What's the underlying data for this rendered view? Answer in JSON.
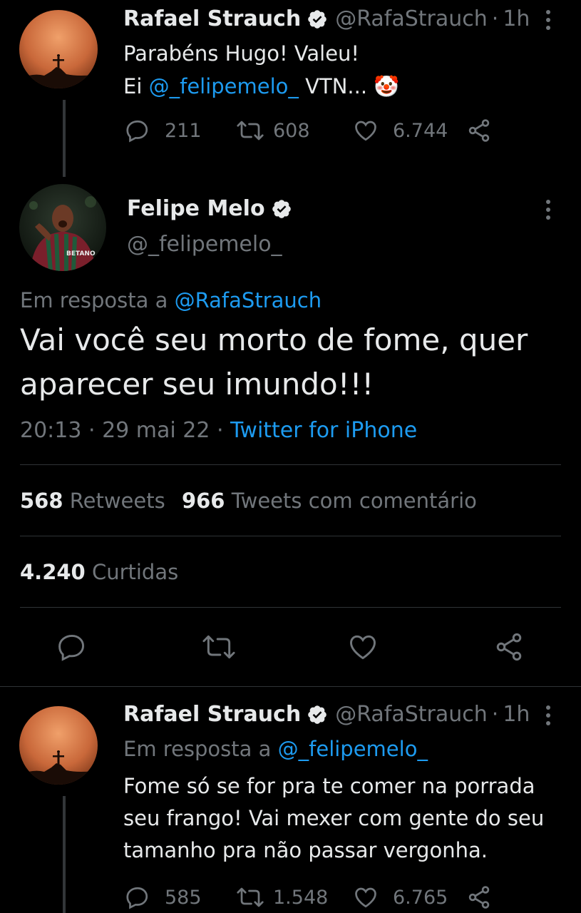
{
  "tweet1": {
    "name": "Rafael Strauch",
    "handle": "@RafaStrauch",
    "time": "1h",
    "line1": "Parabéns Hugo! Valeu!",
    "line2_prefix": "Ei ",
    "line2_mention": "@_felipemelo_",
    "line2_suffix": " VTN... ",
    "emoji": "🤡",
    "replies": "211",
    "retweets": "608",
    "likes": "6.744"
  },
  "main_tweet": {
    "name": "Felipe Melo",
    "handle": "@_felipemelo_",
    "reply_prefix": "Em resposta a ",
    "reply_to": "@RafaStrauch",
    "text_line1": "Vai você seu morto de fome, quer",
    "text_line2": "aparecer seu imundo!!!",
    "timestamp": "20:13 · 29 mai 22 · ",
    "source": "Twitter for iPhone",
    "retweets_count": "568",
    "retweets_label": " Retweets",
    "quotes_count": "966",
    "quotes_label": " Tweets com comentário",
    "likes_count": "4.240",
    "likes_label": " Curtidas"
  },
  "tweet3": {
    "name": "Rafael Strauch",
    "handle": "@RafaStrauch",
    "time": "1h",
    "reply_prefix": "Em resposta a ",
    "reply_to": "@_felipemelo_",
    "line1": "Fome só se for pra te comer na porrada",
    "line2": "seu frango! Vai mexer com gente do seu",
    "line3": "tamanho pra não passar vergonha.",
    "replies": "585",
    "retweets": "1.548",
    "likes": "6.765"
  },
  "colors": {
    "background": "#000000",
    "text": "#e7e9ea",
    "muted": "#71767b",
    "link": "#1d9bf0",
    "divider": "#2f3336"
  }
}
